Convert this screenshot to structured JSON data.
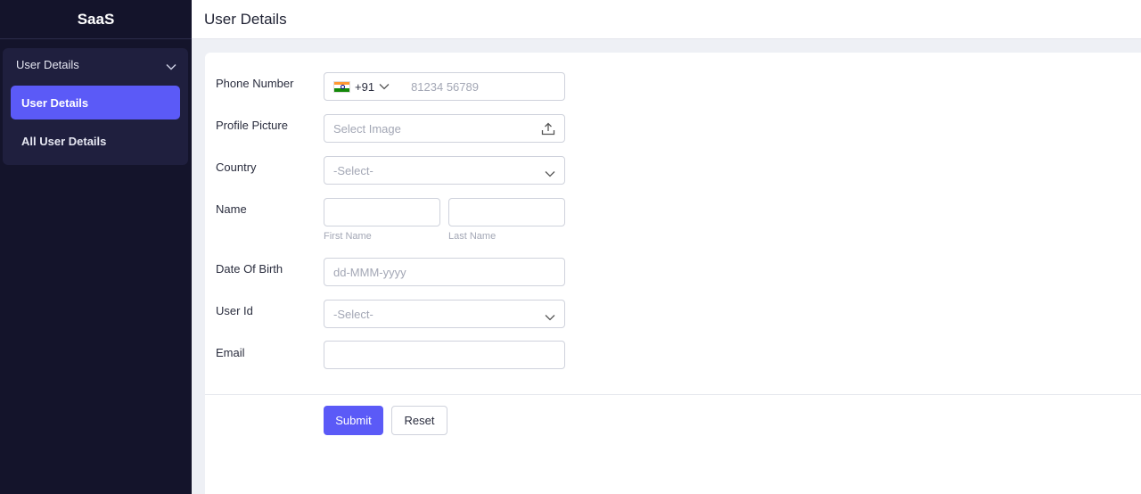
{
  "app": {
    "brand": "SaaS"
  },
  "sidebar": {
    "group_label": "User Details",
    "items": [
      {
        "label": "User Details",
        "active": true
      },
      {
        "label": "All User Details",
        "active": false
      }
    ]
  },
  "header": {
    "title": "User Details"
  },
  "form": {
    "phone": {
      "label": "Phone Number",
      "country_code": "+91",
      "placeholder": "81234 56789"
    },
    "profile_picture": {
      "label": "Profile Picture",
      "placeholder": "Select Image"
    },
    "country": {
      "label": "Country",
      "selected": "-Select-"
    },
    "name": {
      "label": "Name",
      "first_hint": "First Name",
      "last_hint": "Last Name"
    },
    "dob": {
      "label": "Date Of Birth",
      "placeholder": "dd-MMM-yyyy"
    },
    "user_id": {
      "label": "User Id",
      "selected": "-Select-"
    },
    "email": {
      "label": "Email"
    }
  },
  "actions": {
    "submit_label": "Submit",
    "reset_label": "Reset"
  },
  "colors": {
    "sidebar_bg": "#14142b",
    "accent": "#5b5af7"
  },
  "icons": {
    "flag": "india-flag-icon",
    "upload": "upload-icon",
    "chevron": "chevron-down-icon"
  }
}
